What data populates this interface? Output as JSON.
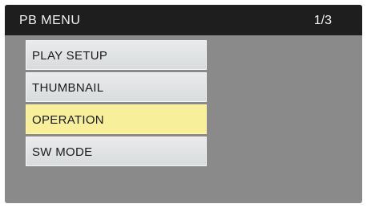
{
  "header": {
    "title": "PB MENU",
    "page": "1/3"
  },
  "menu": {
    "items": [
      {
        "label": "PLAY SETUP",
        "selected": false
      },
      {
        "label": "THUMBNAIL",
        "selected": false
      },
      {
        "label": "OPERATION",
        "selected": true
      },
      {
        "label": "SW MODE",
        "selected": false
      }
    ],
    "highlight_color": "#f7ef9a"
  },
  "colors": {
    "background": "#8a8a8a",
    "title_bar": "#1e1e1e",
    "item": "#e1e3e5"
  }
}
